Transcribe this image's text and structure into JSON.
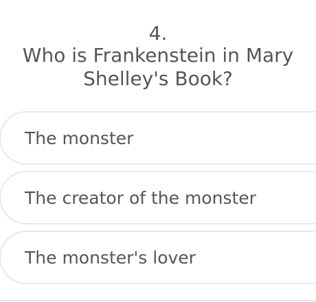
{
  "question": {
    "number": "4.",
    "text": "Who is Frankenstein in Mary Shelley's Book?"
  },
  "options": [
    {
      "label": "The monster"
    },
    {
      "label": "The creator of the monster"
    },
    {
      "label": "The monster's lover"
    }
  ]
}
